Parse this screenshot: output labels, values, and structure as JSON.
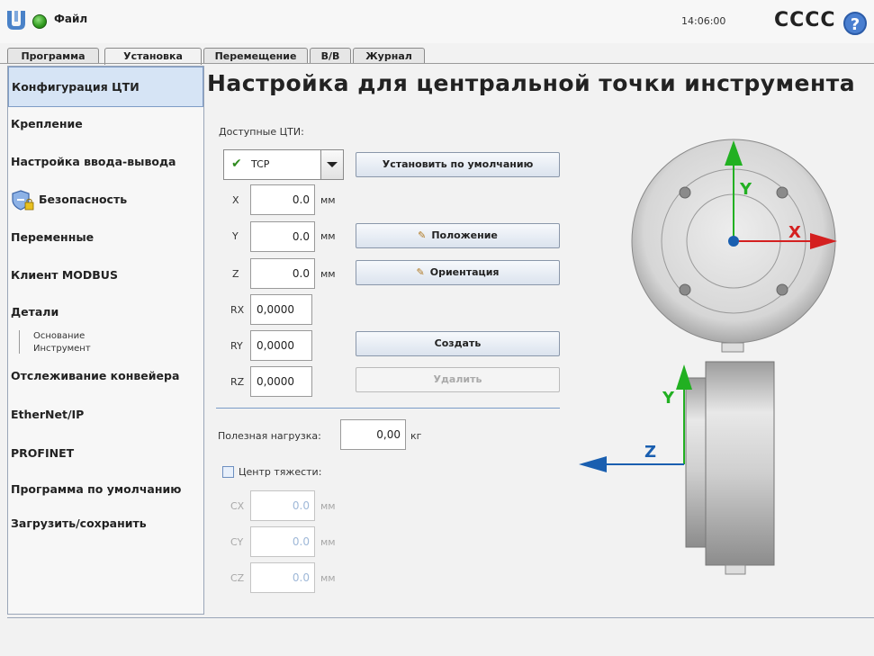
{
  "header": {
    "file_menu": "Файл",
    "clock": "14:06:00",
    "robot_name": "CCCC",
    "help": "?"
  },
  "tabs": [
    "Программа",
    "Установка",
    "Перемещение",
    "В/В",
    "Журнал"
  ],
  "sidebar": {
    "items": [
      "Конфигурация ЦТИ",
      "Крепление",
      "Настройка ввода-вывода",
      "Безопасность",
      "Переменные",
      "Клиент MODBUS",
      "Детали",
      "Отслеживание конвейера",
      "EtherNet/IP",
      "PROFINET",
      "Программа по умолчанию",
      "Загрузить/сохранить"
    ],
    "subitems": [
      "Основание",
      "Инструмент"
    ]
  },
  "main": {
    "title": "Настройка для центральной точки инструмента",
    "available_label": "Доступные ЦТИ:",
    "selected_tcp": "TCP",
    "set_default_button": "Установить по умолчанию",
    "position_button": "Положение",
    "orientation_button": "Ориентация",
    "create_button": "Создать",
    "delete_button": "Удалить",
    "unit_mm": "мм",
    "unit_kg": "кг",
    "fields": {
      "x": {
        "label": "X",
        "value": "0.0"
      },
      "y": {
        "label": "Y",
        "value": "0.0"
      },
      "z": {
        "label": "Z",
        "value": "0.0"
      },
      "rx": {
        "label": "RX",
        "value": "0,0000"
      },
      "ry": {
        "label": "RY",
        "value": "0,0000"
      },
      "rz": {
        "label": "RZ",
        "value": "0,0000"
      }
    },
    "payload_label": "Полезная нагрузка:",
    "payload_value": "0,00",
    "cog_label": "Центр тяжести:",
    "cog": {
      "cx": {
        "label": "CX",
        "value": "0.0"
      },
      "cy": {
        "label": "CY",
        "value": "0.0"
      },
      "cz": {
        "label": "CZ",
        "value": "0.0"
      }
    }
  },
  "illustration": {
    "x_axis": "X",
    "y_axis": "Y",
    "z_axis": "Z",
    "x_color": "#d42020",
    "y_color": "#22b022",
    "z_color": "#1a5fb0"
  }
}
